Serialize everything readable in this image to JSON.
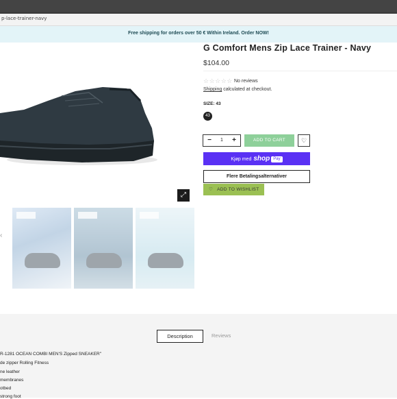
{
  "browser": {
    "url": "p-lace-trainer-navy"
  },
  "promo": {
    "text": "Free shipping for orders over 50 € Within Ireland. Order NOW!"
  },
  "product": {
    "title": "G Comfort Mens Zip Lace Trainer - Navy",
    "price": "$104.00",
    "reviews": "No reviews",
    "shipping_link": "Shipping",
    "shipping_rest": " calculated at checkout.",
    "size_label": "SIZE: 43",
    "size_value": "43",
    "quantity": "1",
    "add_to_cart": "ADD TO CART",
    "shop_pay_prefix": "Kjøp med",
    "shop_pay_brand": "shop",
    "shop_pay_badge": "Pay",
    "more_payment": "Flere Betalingsalternativer",
    "wishlist": "ADD TO WISHLIST"
  },
  "tabs": {
    "description": "Description",
    "reviews": "Reviews"
  },
  "description_lines": [
    "R-1281 OCEAN COMBI MEN'S Zipped SNEAKER\"",
    "de zipper Rolling Fitness",
    "ne leather",
    "membranes",
    "otbed",
    "strong foot"
  ],
  "colors": {
    "promo_bg": "#e3f4f8",
    "add_to_cart": "#8ed09a",
    "shop_pay": "#5a31f4",
    "wishlist": "#9bc053"
  },
  "icons": {
    "stars": "☆☆☆☆☆",
    "heart": "♡",
    "zoom": "⤢",
    "minus": "−",
    "plus": "+"
  }
}
